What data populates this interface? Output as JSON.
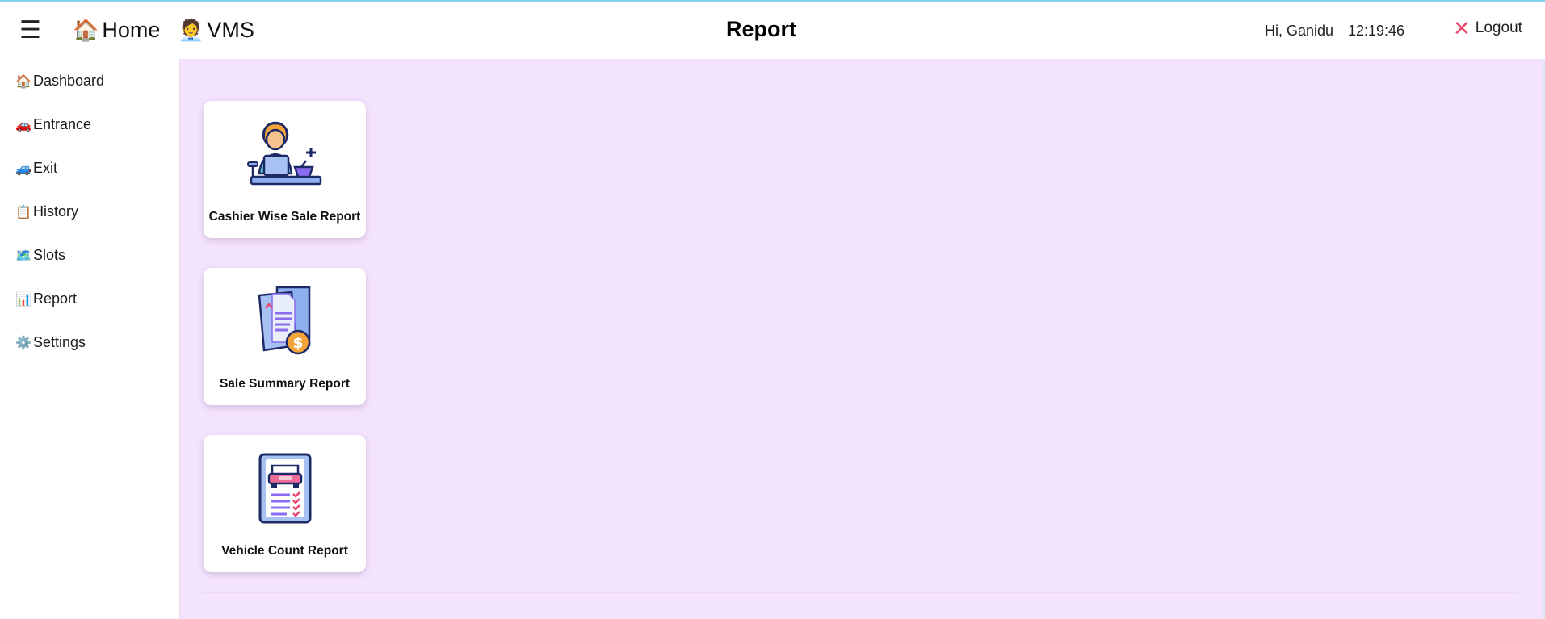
{
  "header": {
    "menu_icon": "hamburger-menu-icon",
    "home": {
      "emoji": "🏠",
      "label": "Home"
    },
    "vms": {
      "emoji": "🧑‍💼",
      "label": "VMS"
    },
    "title": "Report",
    "greeting": "Hi, Ganidu",
    "time": "12:19:46",
    "logout": {
      "icon": "close-icon",
      "label": "Logout",
      "icon_color": "#e8476e"
    }
  },
  "sidebar": {
    "items": [
      {
        "emoji": "🏠",
        "label": "Dashboard"
      },
      {
        "emoji": "🚗",
        "label": "Entrance"
      },
      {
        "emoji": "🚙",
        "label": "Exit"
      },
      {
        "emoji": "📋",
        "label": "History"
      },
      {
        "emoji": "🗺️",
        "label": "Slots"
      },
      {
        "emoji": "📊",
        "label": "Report"
      },
      {
        "emoji": "⚙️",
        "label": "Settings"
      }
    ]
  },
  "reports": [
    {
      "icon": "cashier-icon",
      "label": "Cashier Wise Sale Report"
    },
    {
      "icon": "sale-summary-icon",
      "label": "Sale Summary Report"
    },
    {
      "icon": "vehicle-count-icon",
      "label": "Vehicle Count Report"
    }
  ],
  "colors": {
    "main_background": "#f4e3fd",
    "accent_pink": "#e8476e",
    "navy": "#1e2a66",
    "illustration_blue": "#8fb0ee",
    "illustration_purple": "#8a6cf0",
    "illustration_orange": "#f5a43a",
    "illustration_skin": "#f8c28e"
  }
}
